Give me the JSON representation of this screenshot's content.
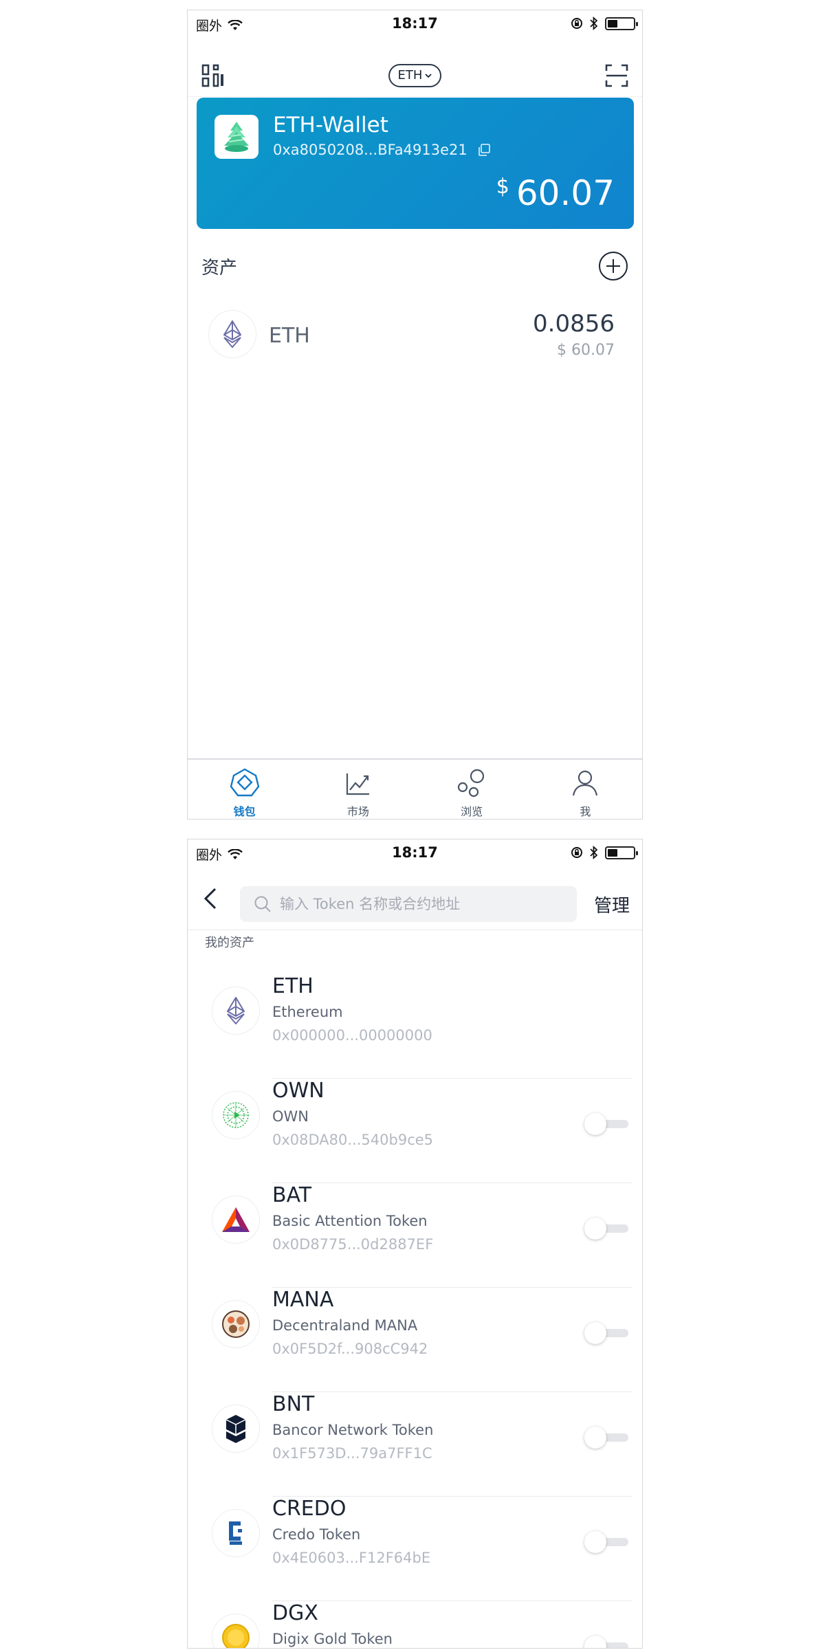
{
  "status_bar": {
    "carrier": "圈外",
    "time": "18:17"
  },
  "wallet_screen": {
    "chain_selector": "ETH",
    "wallet": {
      "name": "ETH-Wallet",
      "address": "0xa8050208...BFa4913e21",
      "currency_symbol": "$",
      "balance": "60.07"
    },
    "assets_title": "资产",
    "assets": [
      {
        "symbol": "ETH",
        "amount": "0.0856",
        "fiat": "$ 60.07"
      }
    ],
    "tabs": [
      {
        "label": "钱包",
        "icon": "wallet-icon",
        "active": true
      },
      {
        "label": "市场",
        "icon": "market-chart-icon",
        "active": false
      },
      {
        "label": "浏览",
        "icon": "browse-icon",
        "active": false
      },
      {
        "label": "我",
        "icon": "profile-icon",
        "active": false
      }
    ]
  },
  "token_screen": {
    "search_placeholder": "输入 Token 名称或合约地址",
    "manage_label": "管理",
    "list_title": "我的资产",
    "tokens": [
      {
        "symbol": "ETH",
        "name": "Ethereum",
        "address": "0x000000...00000000",
        "toggle": false,
        "icon": "eth-icon"
      },
      {
        "symbol": "OWN",
        "name": "OWN",
        "address": "0x08DA80...540b9ce5",
        "toggle": true,
        "enabled": false,
        "icon": "own-icon"
      },
      {
        "symbol": "BAT",
        "name": "Basic Attention Token",
        "address": "0x0D8775...0d2887EF",
        "toggle": true,
        "enabled": false,
        "icon": "bat-icon"
      },
      {
        "symbol": "MANA",
        "name": "Decentraland MANA",
        "address": "0x0F5D2f...908cC942",
        "toggle": true,
        "enabled": false,
        "icon": "mana-icon"
      },
      {
        "symbol": "BNT",
        "name": "Bancor Network Token",
        "address": "0x1F573D...79a7FF1C",
        "toggle": true,
        "enabled": false,
        "icon": "bnt-icon"
      },
      {
        "symbol": "CREDO",
        "name": "Credo Token",
        "address": "0x4E0603...F12F64bE",
        "toggle": true,
        "enabled": false,
        "icon": "credo-icon"
      },
      {
        "symbol": "DGX",
        "name": "Digix Gold Token",
        "address": "",
        "toggle": true,
        "enabled": false,
        "icon": "dgx-icon"
      }
    ]
  },
  "colors": {
    "accent": "#1479c5",
    "card_gradient_start": "#0b9ac8",
    "card_gradient_end": "#1184ce"
  }
}
